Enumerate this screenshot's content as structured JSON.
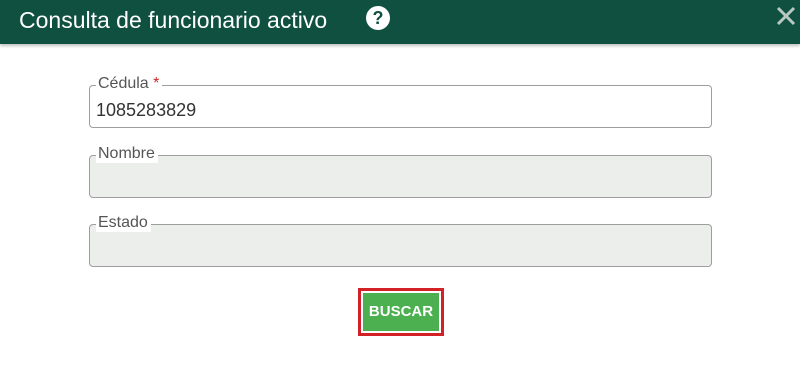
{
  "dialog": {
    "title": "Consulta de funcionario activo",
    "help_icon_label": "?",
    "close_icon": "close-icon",
    "help_icon": "help-circle-icon"
  },
  "form": {
    "cedula": {
      "label": "Cédula",
      "required_mark": "*",
      "value": "1085283829"
    },
    "nombre": {
      "label": "Nombre",
      "value": ""
    },
    "estado": {
      "label": "Estado",
      "value": ""
    }
  },
  "actions": {
    "search_label": "BUSCAR"
  },
  "colors": {
    "header_bg": "#0f5040",
    "button_bg": "#4caf50",
    "highlight_border": "#d32128",
    "required_mark": "#c62828",
    "readonly_field_bg": "#eceeec"
  }
}
